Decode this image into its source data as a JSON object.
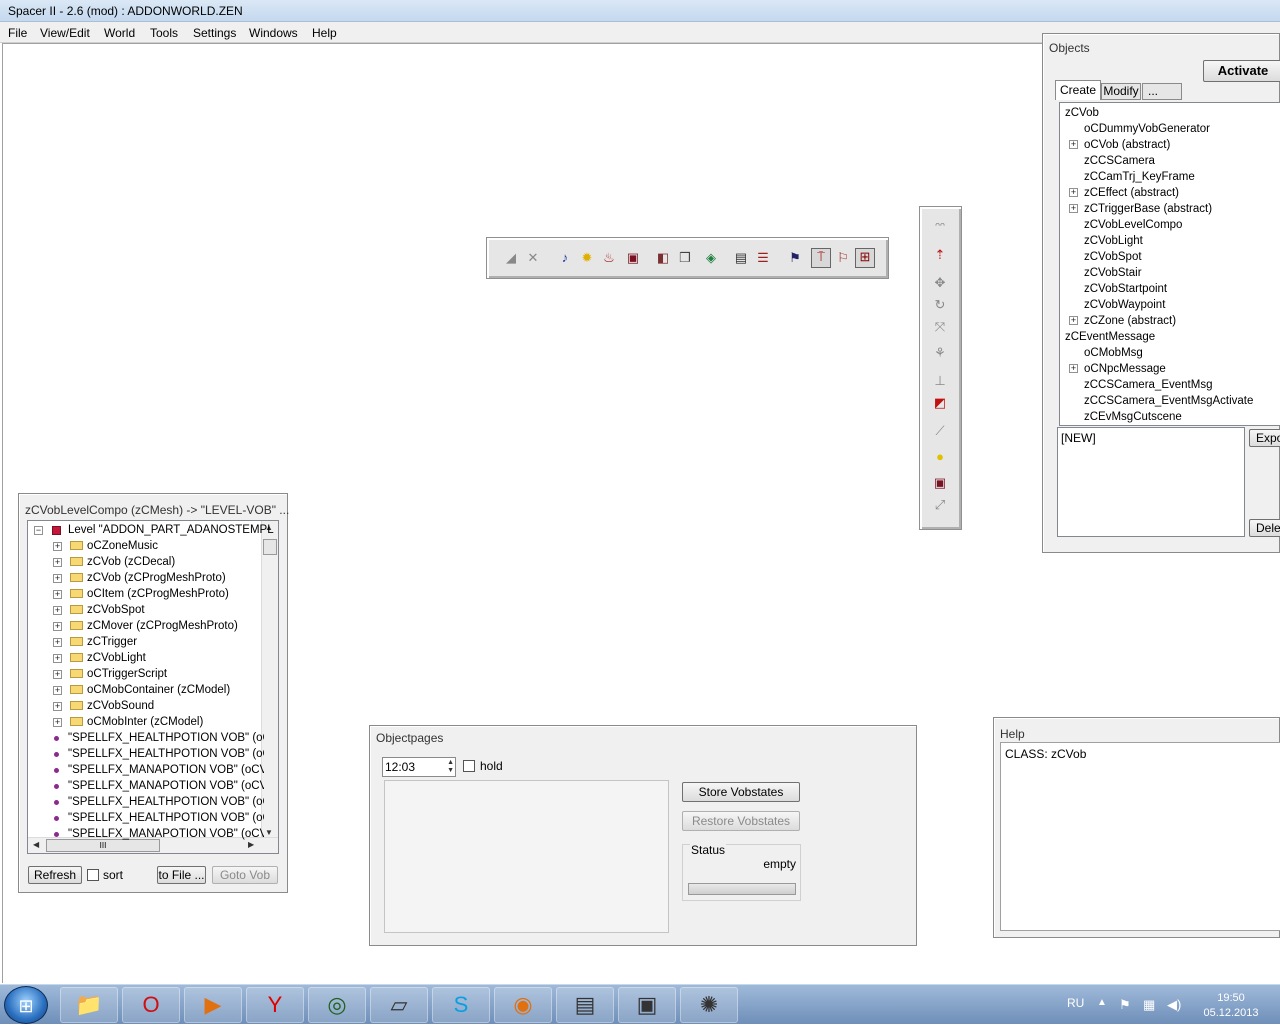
{
  "window": {
    "title": "Spacer II - 2.6 (mod) : ADDONWORLD.ZEN"
  },
  "menu": [
    "File",
    "View/Edit",
    "World",
    "Tools",
    "Settings",
    "Windows",
    "Help"
  ],
  "objects_panel": {
    "title": "Objects",
    "activate_label": "Activate",
    "tabs": [
      "Create",
      "Modify",
      "..."
    ],
    "tree": [
      {
        "label": "zCVob",
        "level": 0,
        "expander": false
      },
      {
        "label": "oCDummyVobGenerator",
        "level": 1,
        "expander": false
      },
      {
        "label": "oCVob (abstract)",
        "level": 1,
        "expander": true
      },
      {
        "label": "zCCSCamera",
        "level": 1,
        "expander": false
      },
      {
        "label": "zCCamTrj_KeyFrame",
        "level": 1,
        "expander": false
      },
      {
        "label": "zCEffect (abstract)",
        "level": 1,
        "expander": true
      },
      {
        "label": "zCTriggerBase (abstract)",
        "level": 1,
        "expander": true
      },
      {
        "label": "zCVobLevelCompo",
        "level": 1,
        "expander": false
      },
      {
        "label": "zCVobLight",
        "level": 1,
        "expander": false
      },
      {
        "label": "zCVobSpot",
        "level": 1,
        "expander": false
      },
      {
        "label": "zCVobStair",
        "level": 1,
        "expander": false
      },
      {
        "label": "zCVobStartpoint",
        "level": 1,
        "expander": false
      },
      {
        "label": "zCVobWaypoint",
        "level": 1,
        "expander": false
      },
      {
        "label": "zCZone (abstract)",
        "level": 1,
        "expander": true
      },
      {
        "label": "zCEventMessage",
        "level": 0,
        "expander": false
      },
      {
        "label": "oCMobMsg",
        "level": 1,
        "expander": false
      },
      {
        "label": "oCNpcMessage",
        "level": 1,
        "expander": true
      },
      {
        "label": "zCCSCamera_EventMsg",
        "level": 1,
        "expander": false
      },
      {
        "label": "zCCSCamera_EventMsgActivate",
        "level": 1,
        "expander": false
      },
      {
        "label": "zCEvMsgCutscene",
        "level": 1,
        "expander": false
      }
    ],
    "preset_text": "[NEW]",
    "export_label": "Expo",
    "delete_label": "Delet"
  },
  "vob_panel": {
    "title": "zCVobLevelCompo (zCMesh) -> \"LEVEL-VOB\" ...",
    "root": "Level \"ADDON_PART_ADANOSTEMPL",
    "folders": [
      "oCZoneMusic",
      "zCVob (zCDecal)",
      "zCVob (zCProgMeshProto)",
      "oCItem (zCProgMeshProto)",
      "zCVobSpot",
      "zCMover (zCProgMeshProto)",
      "zCTrigger",
      "zCVobLight",
      "oCTriggerScript",
      "oCMobContainer (zCModel)",
      "zCVobSound",
      "oCMobInter (zCModel)"
    ],
    "items": [
      "\"SPELLFX_HEALTHPOTION VOB\" (oCV",
      "\"SPELLFX_HEALTHPOTION VOB\" (oCV",
      "\"SPELLFX_MANAPOTION VOB\" (oCVis",
      "\"SPELLFX_MANAPOTION VOB\" (oCVis",
      "\"SPELLFX_HEALTHPOTION VOB\" (oCV",
      "\"SPELLFX_HEALTHPOTION VOB\" (oCV",
      "\"SPELLFX_MANAPOTION VOB\" (oCVis"
    ],
    "scroll_h_label": "III",
    "refresh_label": "Refresh",
    "sort_label": "sort",
    "tofile_label": "to File ...",
    "gotovob_label": "Goto Vob"
  },
  "objectpages": {
    "title": "Objectpages",
    "time_value": "12:03",
    "hold_label": "hold",
    "store_label": "Store Vobstates",
    "restore_label": "Restore Vobstates",
    "status_label": "Status",
    "status_value": "empty"
  },
  "help_panel": {
    "title": "Help",
    "text": "CLASS: zCVob"
  },
  "taskbar": {
    "lang": "RU",
    "time": "19:50",
    "date": "05.12.2013",
    "apps": [
      "explorer-icon",
      "opera-icon",
      "media-player-icon",
      "yandex-icon",
      "gamemaker-icon",
      "notepad-icon",
      "skype-icon",
      "firefox-icon",
      "winrar-icon",
      "window-app-icon",
      "spacer-icon"
    ]
  }
}
